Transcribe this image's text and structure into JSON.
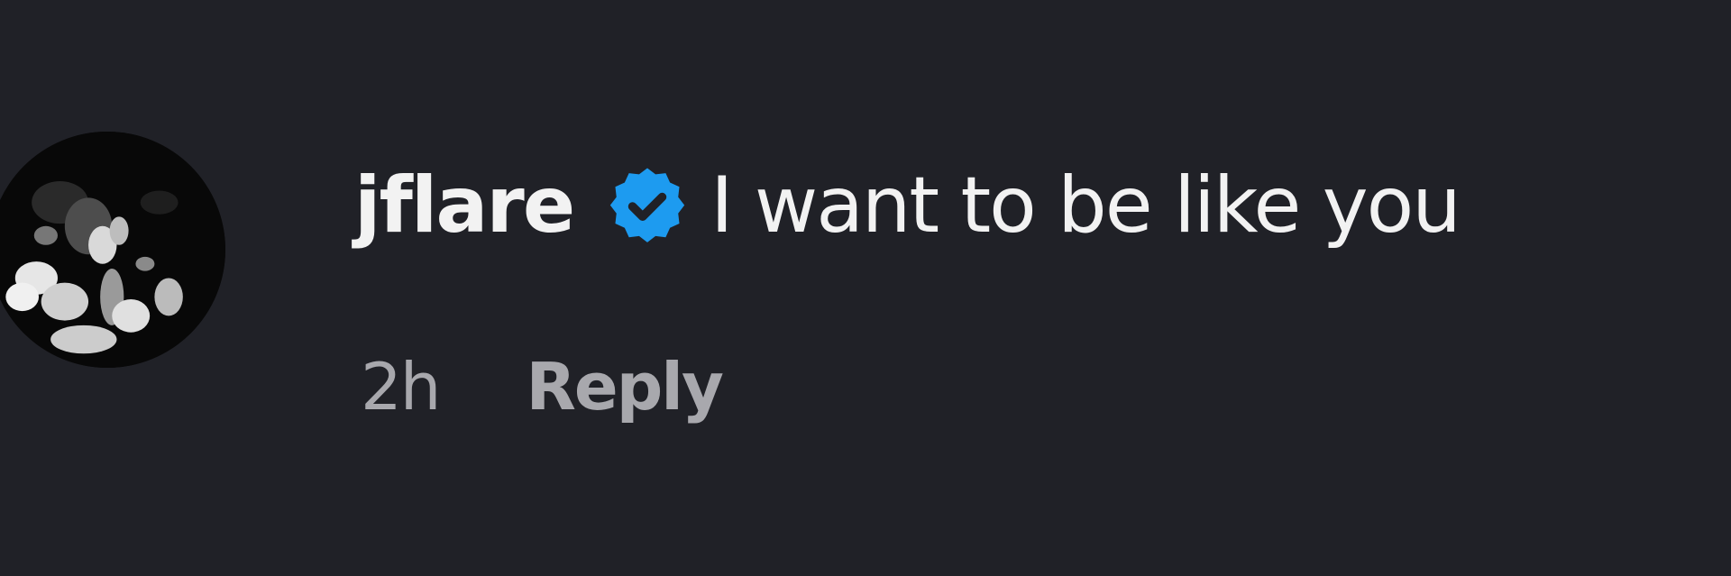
{
  "comment": {
    "username": "jflare",
    "verified_icon": "verified-badge-icon",
    "text": "I want to be like you",
    "timestamp": "2h",
    "reply_label": "Reply",
    "avatar_icon": "profile-photo",
    "colors": {
      "background": "#202127",
      "primary_text": "#f2f2f2",
      "secondary_text": "#a8a8ad",
      "verified_blue": "#1d9bf0"
    }
  }
}
